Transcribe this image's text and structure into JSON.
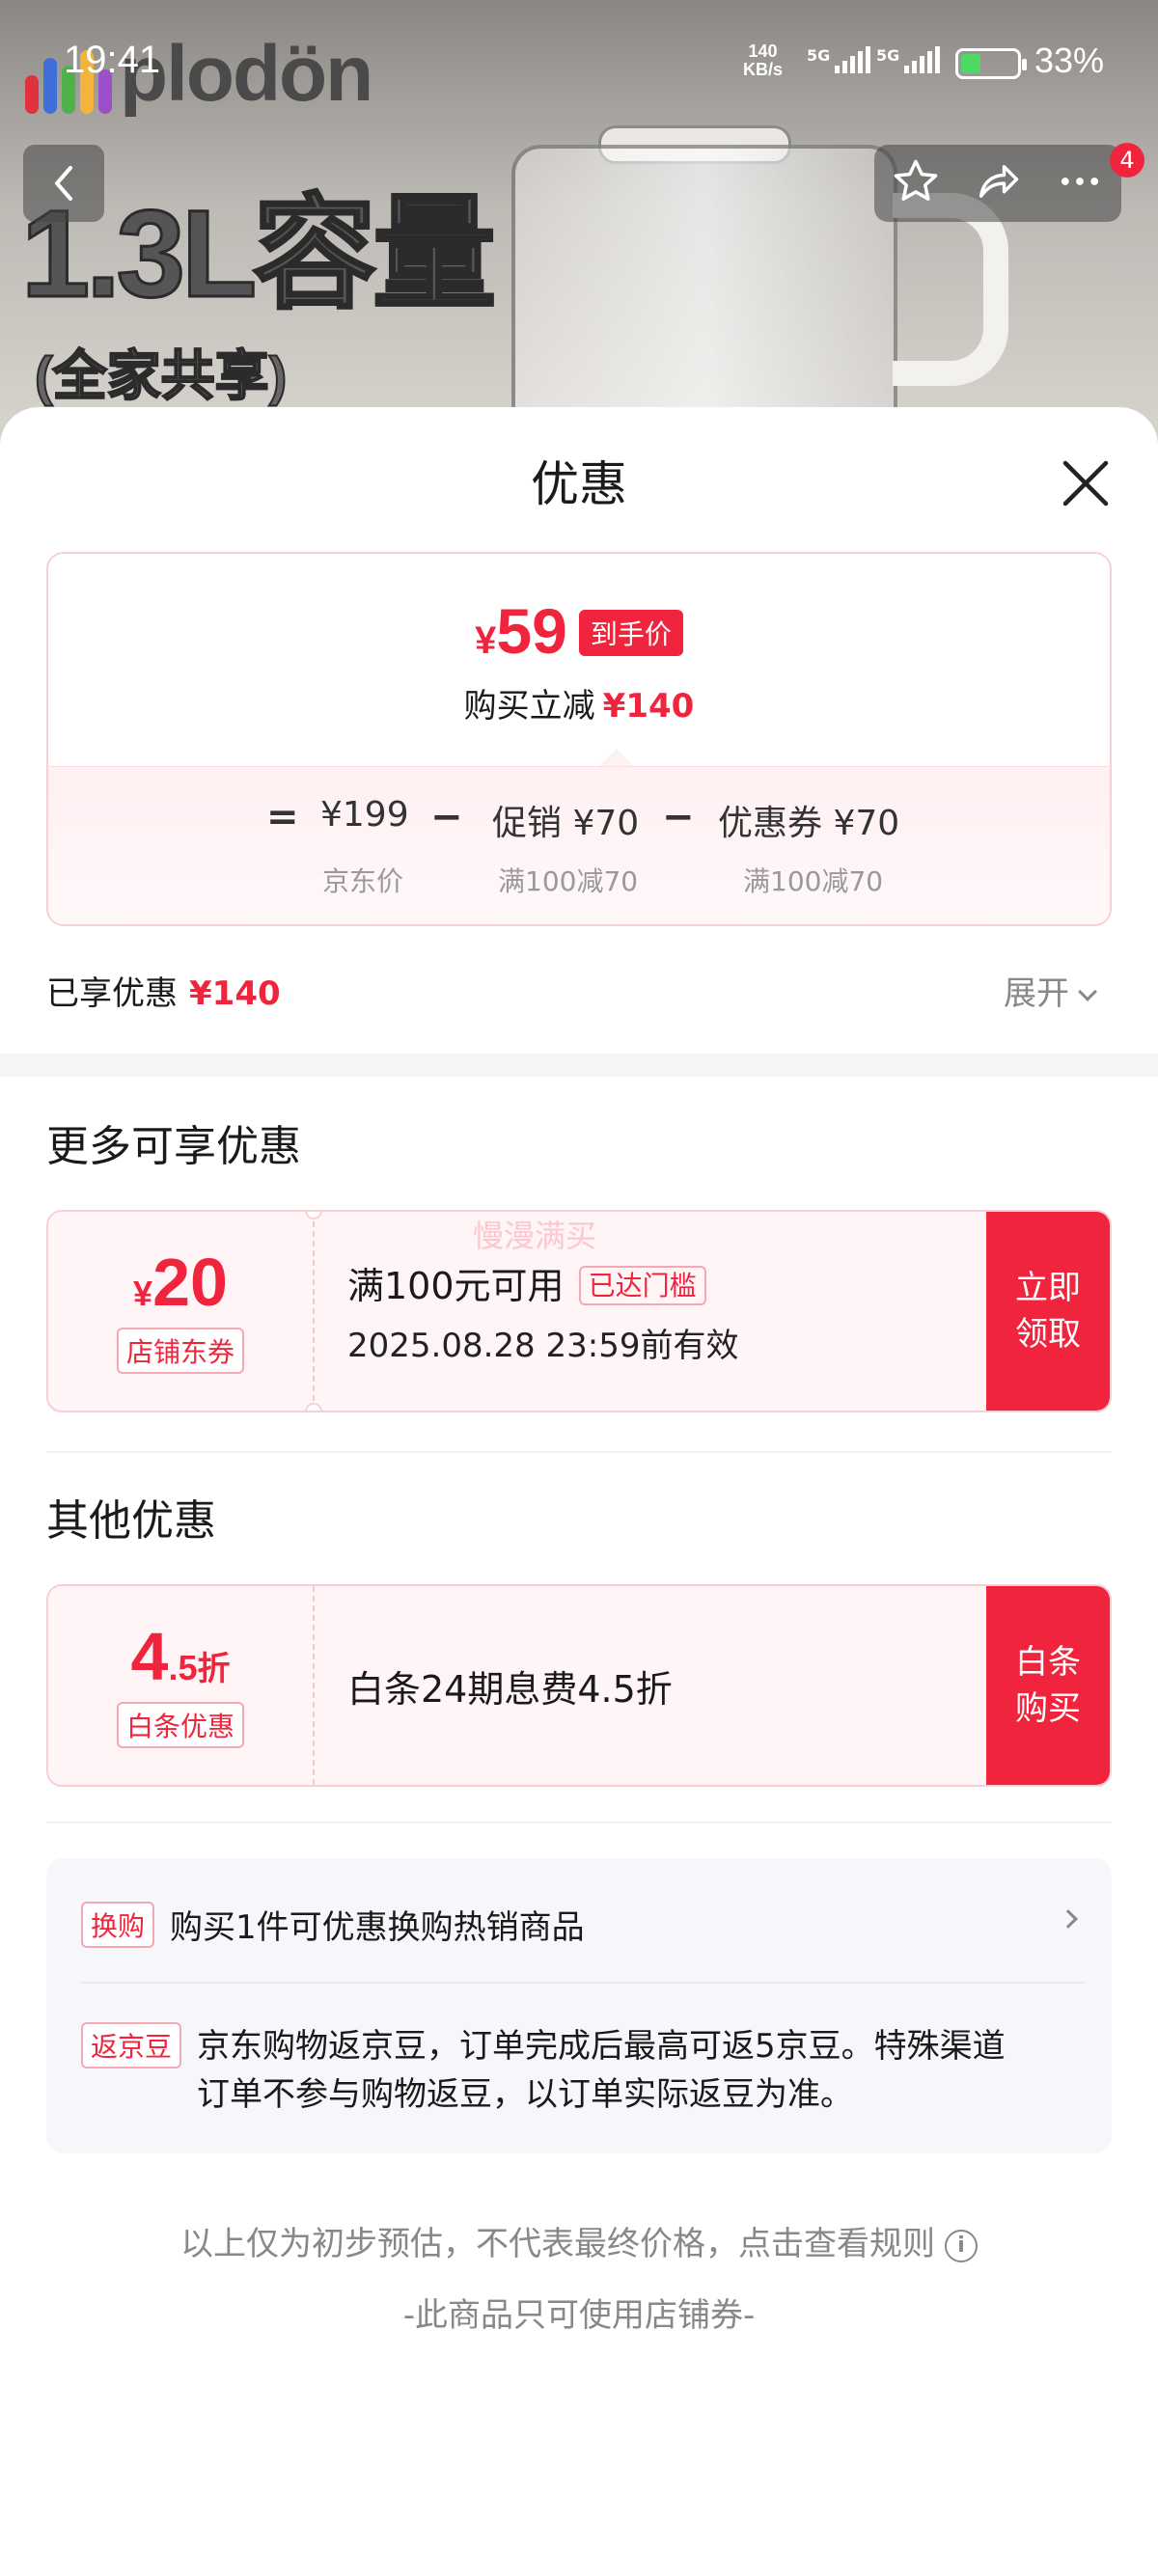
{
  "status_bar": {
    "time": "19:41",
    "net_speed_value": "140",
    "net_speed_unit": "KB/s",
    "sim1": "5G",
    "sim2": "5G",
    "battery": "33%"
  },
  "hero": {
    "brand": "plodön",
    "capacity_big": "1.3L容量",
    "capacity_small": "(全家共享)"
  },
  "top_nav": {
    "badge_count": "4",
    "icons": [
      "back-icon",
      "star-icon",
      "share-icon",
      "more-icon"
    ]
  },
  "sheet": {
    "title": "优惠"
  },
  "price_card": {
    "currency": "¥",
    "final_price": "59",
    "final_tag": "到手价",
    "reduce_label": "购买立减",
    "reduce_amount": "¥140",
    "formula": {
      "equals": "=",
      "base_price": "¥199",
      "base_label": "京东价",
      "minus": "−",
      "promo": "促销 ¥70",
      "promo_label": "满100减70",
      "coupon": "优惠券 ¥70",
      "coupon_label": "满100减70"
    }
  },
  "enjoyed": {
    "label": "已享优惠",
    "amount": "¥140",
    "expand_label": "展开"
  },
  "more_offers": {
    "title": "更多可享优惠",
    "coupon": {
      "symbol": "¥",
      "amount": "20",
      "type": "店铺东券",
      "condition": "满100元可用",
      "reached_tag": "已达门槛",
      "validity": "2025.08.28 23:59前有效",
      "action": "立即领取"
    },
    "watermark": "慢漫满买"
  },
  "other_offers": {
    "title": "其他优惠",
    "baitiao": {
      "amount_int": "4",
      "amount_dec": ".5",
      "amount_unit": "折",
      "type": "白条优惠",
      "description": "白条24期息费4.5折",
      "action": "白条购买"
    }
  },
  "info_box": {
    "exchange_tag": "换购",
    "exchange_text": "购买1件可优惠换购热销商品",
    "bean_tag": "返京豆",
    "bean_text": "京东购物返京豆，订单完成后最高可返5京豆。特殊渠道订单不参与购物返豆，以订单实际返豆为准。"
  },
  "footer": {
    "note": "以上仅为初步预估，不代表最终价格，点击查看规则",
    "info_glyph": "i",
    "shop_only": "-此商品只可使用店铺券-"
  },
  "colors": {
    "accent": "#f0253d",
    "muted": "#888888",
    "card_border": "#f7d0d6",
    "card_bg": "#fff5f6"
  }
}
